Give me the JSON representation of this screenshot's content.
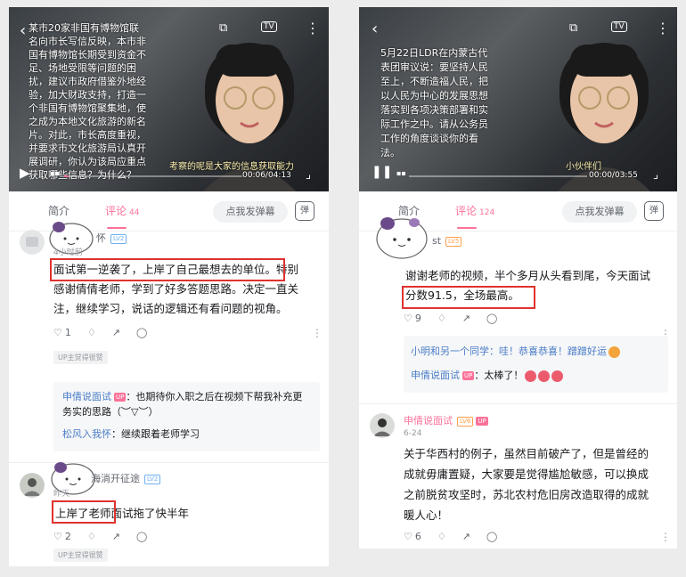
{
  "left": {
    "overlay_text": "某市20家非国有博物馆联名向市长写信反映，本市非国有博物馆长期受到资金不足、场地受限等问题的困扰，建议市政府借鉴外地经验，加大财政支持，打造一个非国有博物馆聚集地，使之成为本地文化旅游的新名片。对此，市长高度重视，并要求市文化旅游局认真开展调研，你认为该局应重点获取哪些信息？为什么？",
    "subtitle": "考察的呢是大家的信息获取能力",
    "time": "00:06/04:13",
    "progress": 0.024,
    "tab_intro": "简介",
    "tab_comments": "评论",
    "comment_count": "44",
    "danmaku_placeholder": "点我发弹幕",
    "danmaku_icon": "弹",
    "c1": {
      "name": "怀",
      "level": "LV2",
      "time": "4小时前",
      "line1": "面试第一逆袭了，上岸了自己最想去的单位。",
      "line1_tail": "特别",
      "line2": "感谢倩倩老师，学到了好多答题思路。决定一直关",
      "line3": "注，继续学习，说话的逻辑还有看问题的视角。",
      "likes": "1",
      "up_tag": "UP主觉得很赞",
      "reply1_name": "申倩说面试",
      "reply1_badge": "UP",
      "reply1_text": "：也期待你入职之后在视频下帮我补充更务实的思路（︶▽︶）",
      "reply2_name": "松风入我怀",
      "reply2_text": "：继续跟着老师学习"
    },
    "c2": {
      "name": "海淌开征途",
      "level": "LV2",
      "time": "昨天",
      "hl": "上岸了老师",
      "rest": "面试拖了快半年",
      "likes": "2",
      "up_tag": "UP主觉得很赞"
    }
  },
  "right": {
    "overlay_text": "5月22日LDR在内蒙古代表团审议说：要坚持人民至上，不断造福人民，把以人民为中心的发展思想落实到各项决策部署和实际工作之中。请从公务员工作的角度谈谈你的看法。",
    "subtitle": "小伙伴们",
    "time": "00:00/03:55",
    "progress": 0.0,
    "tab_intro": "简介",
    "tab_comments": "评论",
    "comment_count": "124",
    "danmaku_placeholder": "点我发弹幕",
    "danmaku_icon": "弹",
    "c1": {
      "name": "st",
      "level": "LV5",
      "line1": "谢谢老师的视频，半个多月从头看到尾，今天面试",
      "hl": "分数91.5，全场最高。",
      "likes": "9",
      "reply1": "小明和另一个同学：哇！恭喜恭喜！蹭蹭好运",
      "reply2_name": "申倩说面试",
      "reply2_badge": "UP",
      "reply2_text": "：太棒了！"
    },
    "c2": {
      "name": "申倩说面试",
      "level": "LV6",
      "badge": "UP",
      "time": "6-24",
      "lines": [
        "关于华西村的例子，虽然目前破产了，但是曾经的",
        "成就毋庸置疑，大家要是觉得尴尬敏感，可以换成",
        "之前脱贫攻坚时，苏北农村危旧房改造取得的成就",
        "暖人心！"
      ],
      "likes": "6"
    }
  },
  "colors": {
    "accent": "#fb7299",
    "highlight": "#e0322f",
    "link": "#4a7cc7"
  },
  "icons": [
    "back-icon",
    "cast-icon",
    "tv-icon",
    "more-icon",
    "play-icon",
    "pause-icon",
    "fullscreen-icon",
    "like-icon",
    "dislike-icon",
    "share-icon",
    "reply-icon",
    "danmaku-icon"
  ]
}
